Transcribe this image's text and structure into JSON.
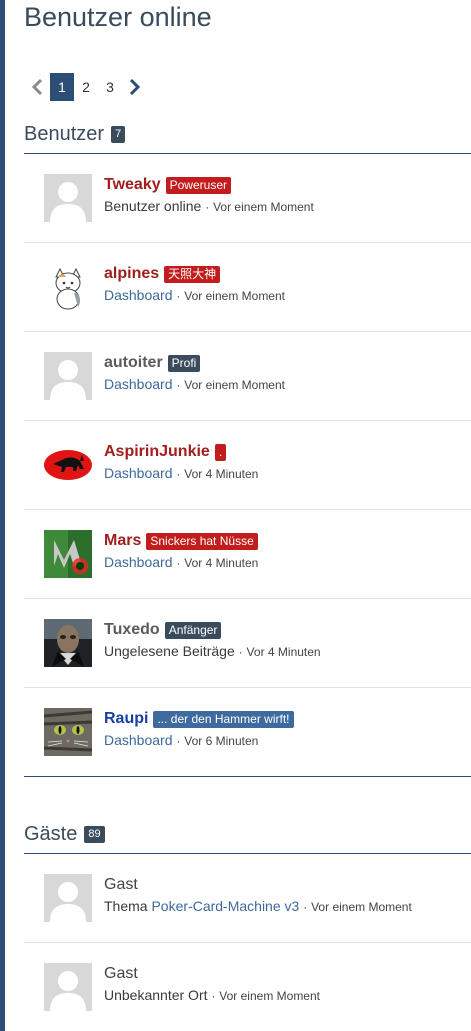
{
  "page": {
    "title": "Benutzer online"
  },
  "pagination": {
    "pages": [
      "1",
      "2",
      "3"
    ],
    "current_index": 0
  },
  "users_section": {
    "title": "Benutzer",
    "count": "7",
    "items": [
      {
        "name": "Tweaky",
        "rank": "Poweruser",
        "location": "Benutzer online",
        "location_is_link": false,
        "time": "Vor einem Moment"
      },
      {
        "name": "alpines",
        "rank": "天照大神",
        "location": "Dashboard",
        "location_is_link": true,
        "time": "Vor einem Moment"
      },
      {
        "name": "autoiter",
        "rank": "Profi",
        "location": "Dashboard",
        "location_is_link": true,
        "time": "Vor einem Moment"
      },
      {
        "name": "AspirinJunkie",
        "rank": ".",
        "location": "Dashboard",
        "location_is_link": true,
        "time": "Vor 4 Minuten"
      },
      {
        "name": "Mars",
        "rank": "Snickers hat Nüsse",
        "location": "Dashboard",
        "location_is_link": true,
        "time": "Vor 4 Minuten"
      },
      {
        "name": "Tuxedo",
        "rank": "Anfänger",
        "location": "Ungelesene Beiträge",
        "location_is_link": false,
        "time": "Vor 4 Minuten"
      },
      {
        "name": "Raupi",
        "rank": "... der den Hammer wirft!",
        "location": "Dashboard",
        "location_is_link": true,
        "time": "Vor 6 Minuten"
      }
    ]
  },
  "guests_section": {
    "title": "Gäste",
    "count": "89",
    "items": [
      {
        "name": "Gast",
        "location_prefix": "Thema",
        "location": "Poker-Card-Machine v3",
        "time": "Vor einem Moment"
      },
      {
        "name": "Gast",
        "location": "Unbekannter Ort",
        "time": "Vor einem Moment"
      }
    ]
  },
  "separator": "·",
  "colors": {
    "accent": "#2c4d76",
    "rank_red": "#c31c1c",
    "rank_dark": "#3a4b5c",
    "rank_blue": "#3f6aa0",
    "name_red": "#a11e1e",
    "name_blue": "#1a3ea8",
    "link": "#3d6a99"
  }
}
